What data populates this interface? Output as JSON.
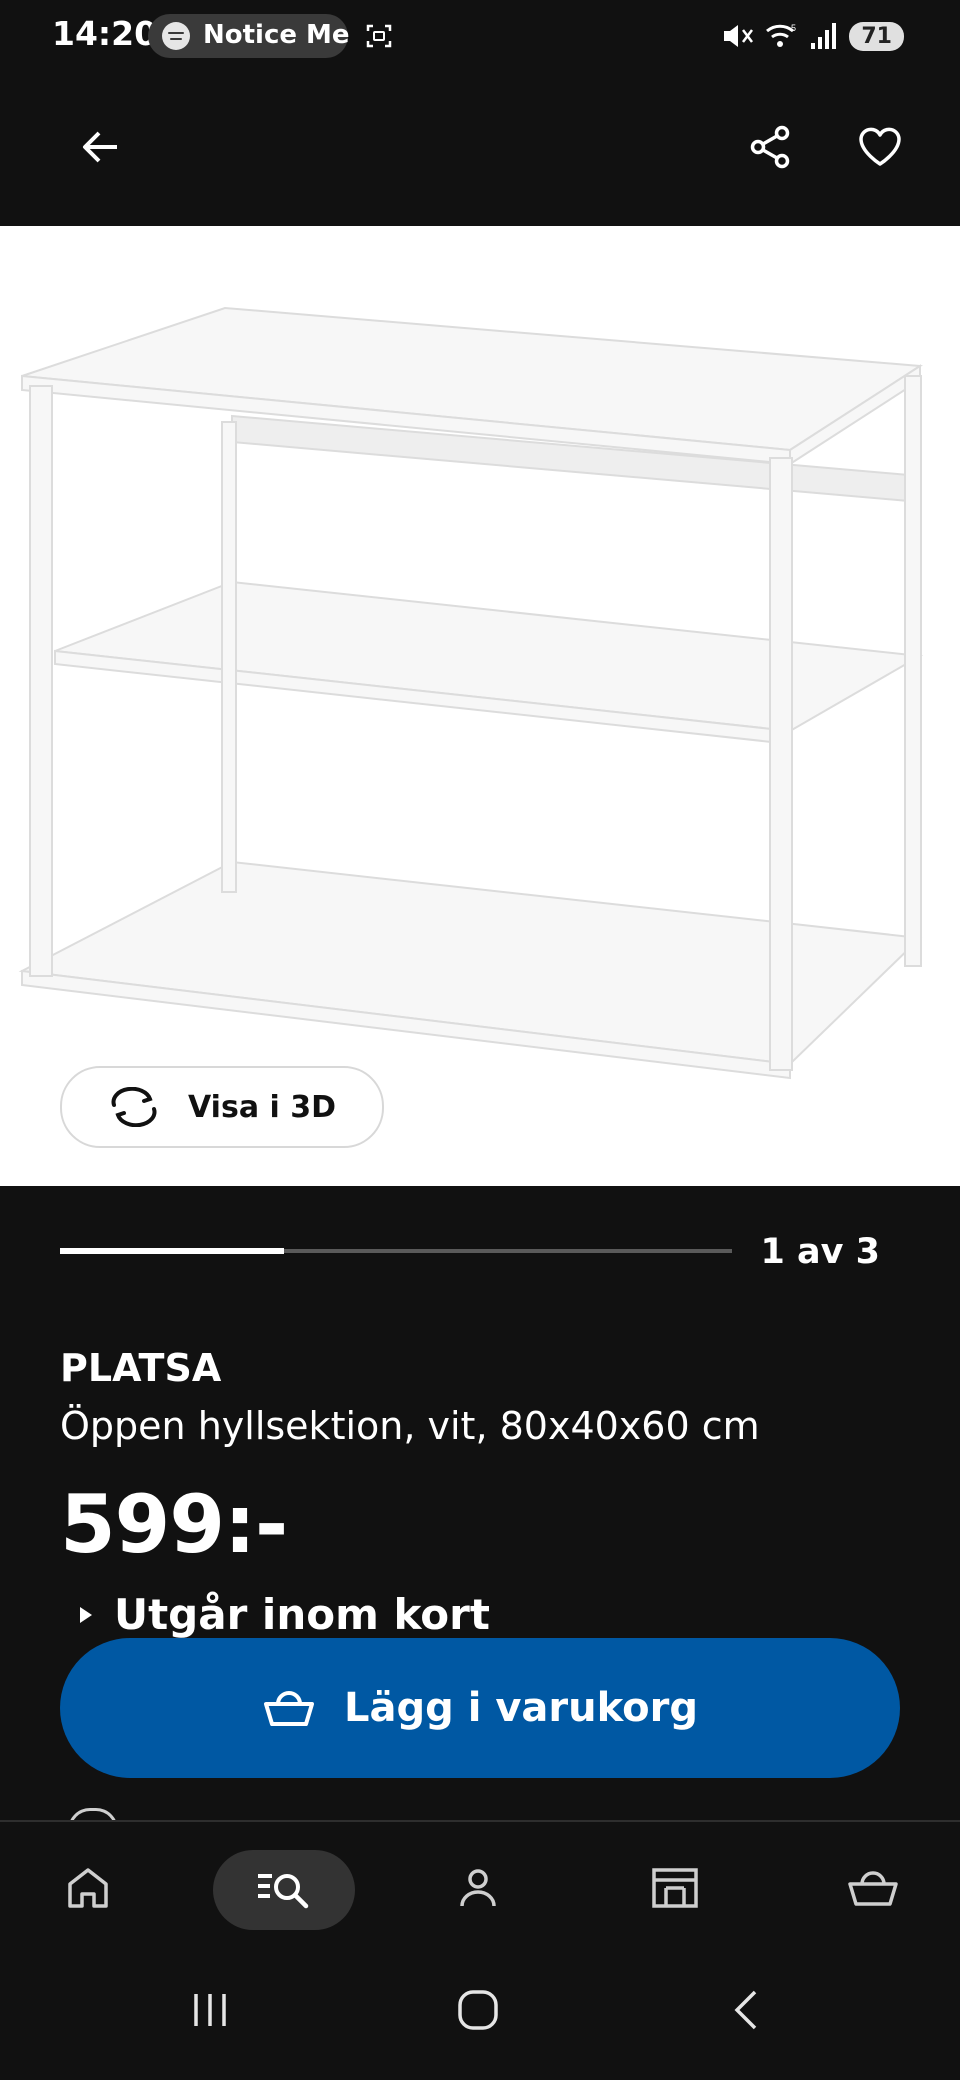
{
  "status_bar": {
    "time": "14:20",
    "now_playing": "Notice Me",
    "battery": "71",
    "icons": [
      "spotify-icon",
      "screenshot-icon",
      "mute-icon",
      "wifi-icon",
      "signal-icon",
      "battery-icon"
    ]
  },
  "app_bar": {
    "icons": {
      "back": "arrow-left-icon",
      "share": "share-icon",
      "favorite": "heart-icon"
    }
  },
  "gallery": {
    "view_3d_label": "Visa i 3D",
    "page_indicator": "1 av 3",
    "current_page": 1,
    "total_pages": 3
  },
  "product": {
    "name": "PLATSA",
    "description": "Öppen hyllsektion, vit, 80x40x60 cm",
    "price": "599:-",
    "availability": "Utgår inom kort"
  },
  "actions": {
    "add_to_cart_label": "Lägg i varukorg"
  },
  "bottom_nav": {
    "items": [
      {
        "id": "home",
        "icon": "home-icon"
      },
      {
        "id": "search",
        "icon": "search-list-icon",
        "active": true
      },
      {
        "id": "profile",
        "icon": "person-icon"
      },
      {
        "id": "stores",
        "icon": "store-icon"
      },
      {
        "id": "cart",
        "icon": "basket-icon"
      }
    ]
  },
  "colors": {
    "background": "#111111",
    "image_background": "#ffffff",
    "primary_button": "#0058a3",
    "active_nav_pill": "#333333"
  }
}
